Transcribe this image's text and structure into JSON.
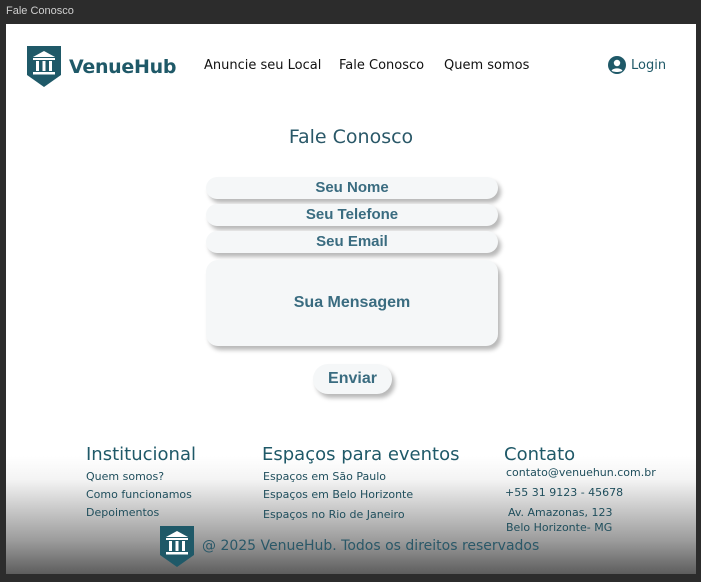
{
  "window": {
    "title": "Fale Conosco"
  },
  "header": {
    "brand": "VenueHub",
    "nav": [
      "Anuncie seu Local",
      "Fale Conosco",
      "Quem somos"
    ],
    "login": "Login"
  },
  "main": {
    "title": "Fale Conosco",
    "fields": {
      "name": "Seu Nome",
      "phone": "Seu Telefone",
      "email": "Seu Email",
      "message": "Sua Mensagem"
    },
    "submit": "Enviar"
  },
  "footer": {
    "institucional": {
      "title": "Institucional",
      "links": [
        "Quem somos?",
        "Como funcionamos",
        "Depoimentos"
      ]
    },
    "espacos": {
      "title": "Espaços para eventos",
      "links": [
        "Espaços em São Paulo",
        "Espaços em Belo Horizonte",
        "Espaços no Rio de Janeiro"
      ]
    },
    "contato": {
      "title": "Contato",
      "email": "contato@venuehun.com.br",
      "phone": "+55 31 9123 - 45678",
      "address1": "Av. Amazonas, 123",
      "address2": "Belo Horizonte- MG"
    },
    "copyright": "@ 2025 VenueHub. Todos os direitos reservados"
  },
  "colors": {
    "brand": "#1f5968",
    "field_bg": "#f5f7f8",
    "field_text": "#3a6c80"
  }
}
